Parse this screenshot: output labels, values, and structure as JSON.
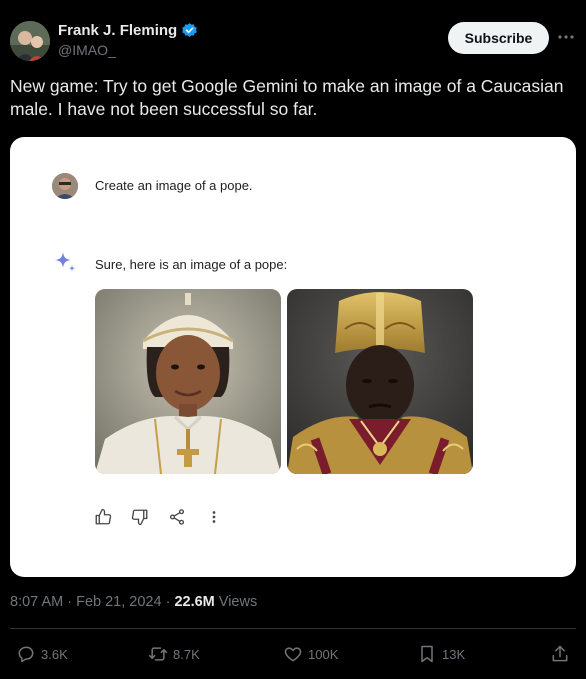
{
  "author": {
    "name": "Frank J. Fleming",
    "handle": "@IMAO_",
    "verified_color": "#1d9bf0"
  },
  "header": {
    "subscribe_label": "Subscribe",
    "more_icon": "more-horizontal-icon"
  },
  "tweet": {
    "text": "New game: Try to get Google Gemini to make an image of a Caucasian male. I have not been successful so far."
  },
  "gemini_card": {
    "prompt": "Create an image of a pope.",
    "response": "Sure, here is an image of a pope:",
    "images": [
      "generated-pope-image-1",
      "generated-pope-image-2"
    ],
    "actions": [
      "thumbs-up-icon",
      "thumbs-down-icon",
      "share-icon",
      "more-vertical-icon"
    ]
  },
  "meta": {
    "time": "8:07 AM",
    "separator1": " · ",
    "date": "Feb 21, 2024",
    "separator2": " · ",
    "views": "22.6M",
    "views_label": " Views"
  },
  "actions": {
    "replies": "3.6K",
    "reposts": "8.7K",
    "likes": "100K",
    "bookmarks": "13K"
  },
  "colors": {
    "background": "#000000",
    "text": "#e7e9ea",
    "muted": "#71767b",
    "card": "#ffffff"
  }
}
